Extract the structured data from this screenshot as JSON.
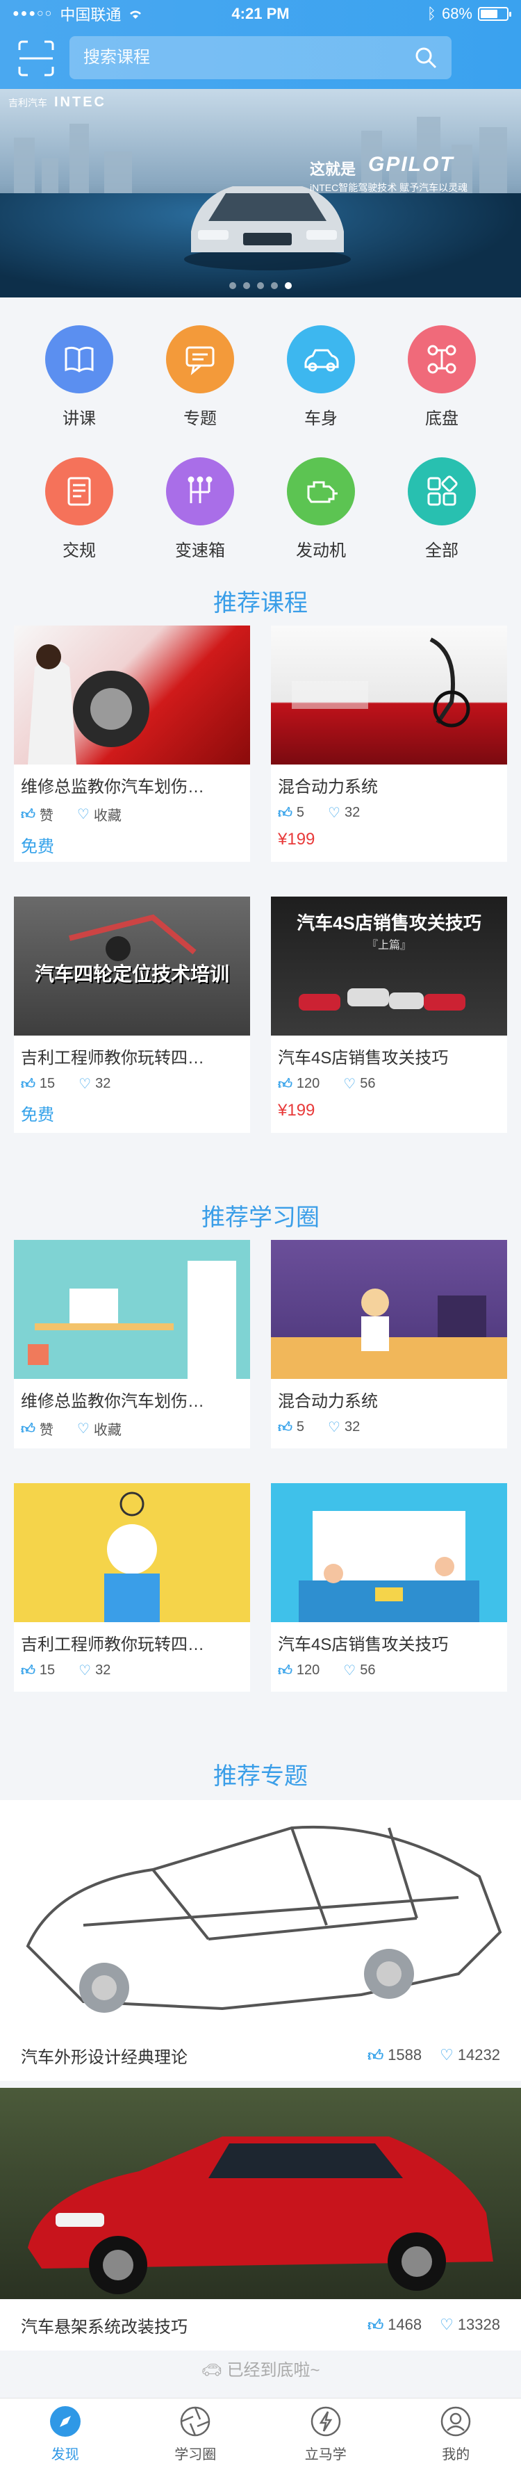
{
  "status": {
    "carrier": "中国联通",
    "time": "4:21 PM",
    "battery": "68%",
    "battery_level": 0.68
  },
  "search": {
    "placeholder": "搜索课程"
  },
  "banner": {
    "brand_small": "吉利汽车",
    "brand": "INTEC",
    "tagline": "这就是",
    "product": "GPILOT",
    "subline": "iNTEC智能驾驶技术 赋予汽车以灵魂",
    "dots": 5,
    "active_dot": 4
  },
  "categories": [
    {
      "label": "讲课",
      "icon": "book-icon",
      "color": "#5b8ff0"
    },
    {
      "label": "专题",
      "icon": "chat-icon",
      "color": "#f39a3a"
    },
    {
      "label": "车身",
      "icon": "car-icon",
      "color": "#3db7ef"
    },
    {
      "label": "底盘",
      "icon": "chassis-icon",
      "color": "#f06a7a"
    },
    {
      "label": "交规",
      "icon": "document-icon",
      "color": "#f5725a"
    },
    {
      "label": "变速箱",
      "icon": "gearbox-icon",
      "color": "#a96ee8"
    },
    {
      "label": "发动机",
      "icon": "engine-icon",
      "color": "#5cc452"
    },
    {
      "label": "全部",
      "icon": "grid-icon",
      "color": "#28c0b0"
    }
  ],
  "sections": {
    "courses": "推荐课程",
    "circles": "推荐学习圈",
    "topics": "推荐专题"
  },
  "courses": [
    {
      "title": "维修总监教你汽车划伤…",
      "like": "赞",
      "fav": "收藏",
      "price": "免费",
      "free": true
    },
    {
      "title": "混合动力系统",
      "like": "5",
      "fav": "32",
      "price": "¥199",
      "free": false
    },
    {
      "title": "吉利工程师教你玩转四…",
      "like": "15",
      "fav": "32",
      "price": "免费",
      "free": true,
      "overlay": "汽车四轮定位技术培训"
    },
    {
      "title": "汽车4S店销售攻关技巧",
      "like": "120",
      "fav": "56",
      "price": "¥199",
      "free": false,
      "overlay": "汽车4S店销售攻关技巧",
      "overlay2": "『上篇』"
    }
  ],
  "circles": [
    {
      "title": "维修总监教你汽车划伤…",
      "like": "赞",
      "fav": "收藏"
    },
    {
      "title": "混合动力系统",
      "like": "5",
      "fav": "32"
    },
    {
      "title": "吉利工程师教你玩转四…",
      "like": "15",
      "fav": "32"
    },
    {
      "title": "汽车4S店销售攻关技巧",
      "like": "120",
      "fav": "56"
    }
  ],
  "topics": [
    {
      "title": "汽车外形设计经典理论",
      "like": "1588",
      "fav": "14232"
    },
    {
      "title": "汽车悬架系统改装技巧",
      "like": "1468",
      "fav": "13328"
    }
  ],
  "end_note": "已经到底啦~",
  "tabs": [
    {
      "label": "发现",
      "active": true,
      "icon": "compass-icon"
    },
    {
      "label": "学习圈",
      "active": false,
      "icon": "aperture-icon"
    },
    {
      "label": "立马学",
      "active": false,
      "icon": "lightning-icon"
    },
    {
      "label": "我的",
      "active": false,
      "icon": "user-icon"
    }
  ],
  "colors": {
    "accent": "#3a9ee8",
    "price": "#e83a3a",
    "header": "#3aa2ef"
  }
}
